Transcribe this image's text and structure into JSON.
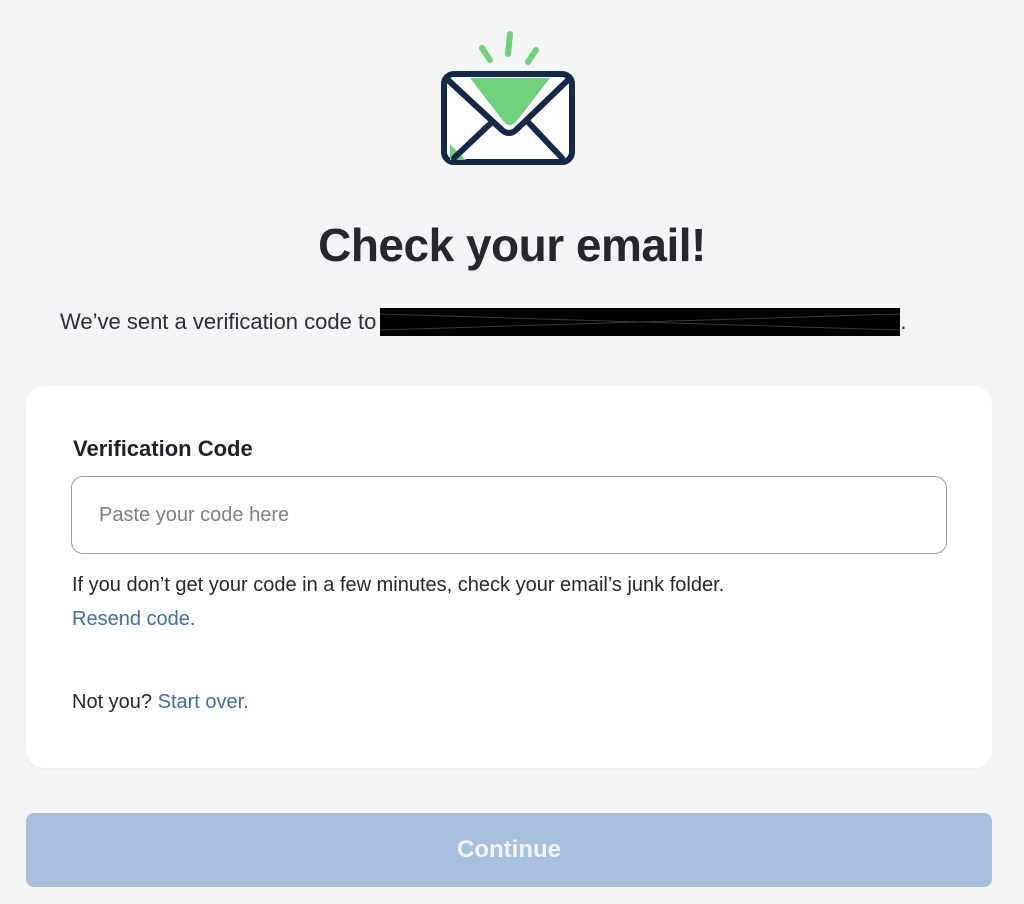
{
  "header": {
    "title": "Check your email!",
    "sent_prefix": "We’ve sent a verification code to",
    "sent_suffix": "."
  },
  "form": {
    "label": "Verification Code",
    "input": {
      "value": "",
      "placeholder": "Paste your code here"
    },
    "help_text": "If you don’t get your code in a few minutes, check your email’s junk folder.",
    "resend_link": "Resend code.",
    "not_you_text": "Not you?",
    "start_over_link": "Start over."
  },
  "footer": {
    "continue_label": "Continue"
  },
  "icons": {
    "mail": "envelope-icon",
    "redaction": "redacted-email"
  },
  "colors": {
    "background": "#f4f5f7",
    "card": "#ffffff",
    "link": "#3f6ea6",
    "button_disabled": "#a8c0de",
    "icon_green": "#6fd17a",
    "icon_navy": "#14284a"
  }
}
